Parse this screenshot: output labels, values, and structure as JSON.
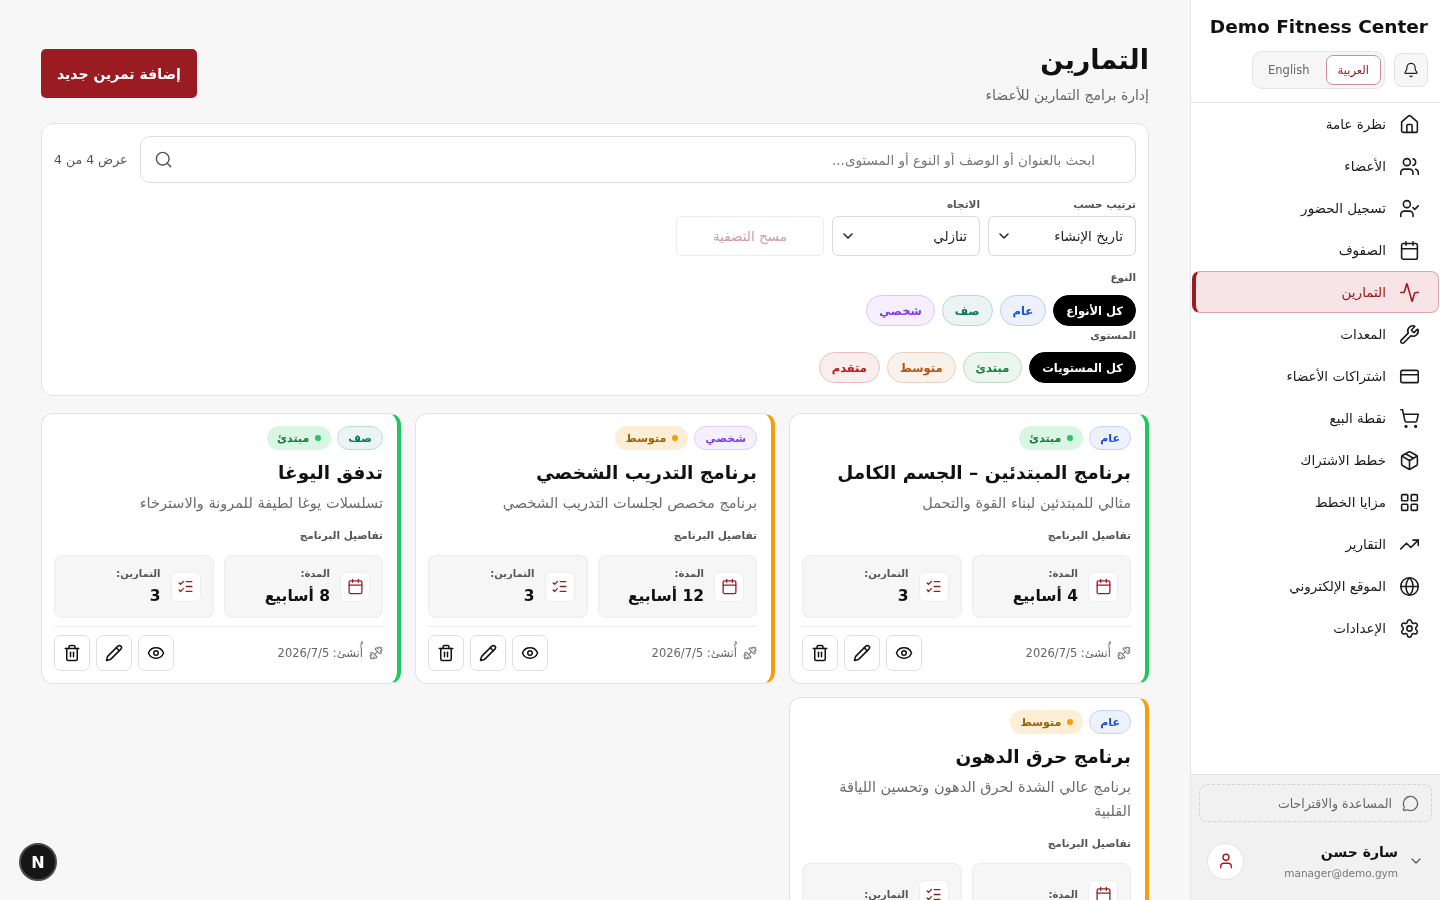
{
  "sidebar": {
    "brand": "Demo Fitness Center",
    "languages": [
      {
        "label": "العربية",
        "selected": true
      },
      {
        "label": "English",
        "selected": false
      }
    ],
    "nav": [
      {
        "label": "نظرة عامة",
        "selected": false
      },
      {
        "label": "الأعضاء",
        "selected": false
      },
      {
        "label": "تسجيل الحضور",
        "selected": false
      },
      {
        "label": "الصفوف",
        "selected": false
      },
      {
        "label": "التمارين",
        "selected": true
      },
      {
        "label": "المعدات",
        "selected": false
      },
      {
        "label": "اشتراكات الأعضاء",
        "selected": false
      },
      {
        "label": "نقطة البيع",
        "selected": false
      },
      {
        "label": "خطط الاشتراك",
        "selected": false
      },
      {
        "label": "مزايا الخطط",
        "selected": false
      },
      {
        "label": "التقارير",
        "selected": false
      },
      {
        "label": "الموقع الإلكتروني",
        "selected": false
      },
      {
        "label": "الإعدادات",
        "selected": false
      }
    ],
    "help_button": "المساعدة والاقتراحات",
    "user": {
      "name": "سارة حسن",
      "email": "manager@demo.gym"
    }
  },
  "header": {
    "title": "التمارين",
    "subtitle": "إدارة برامج التمارين للأعضاء",
    "add_button": "إضافة تمرين جديد"
  },
  "filters": {
    "search": {
      "placeholder": "ابحث بالعنوان أو الوصف أو النوع أو المستوى..."
    },
    "result_count": "عرض 4 من 4",
    "selects": [
      {
        "label": "ترتيب حسب",
        "value": "تاريخ الإنشاء"
      },
      {
        "label": "الاتجاه",
        "value": "تنازلي"
      }
    ],
    "clear_button": {
      "label": "مسح التصفية",
      "disabled": true
    },
    "type_filter": {
      "label": "النوع",
      "chips": [
        {
          "label": "كل الأنواع",
          "selected": true
        },
        {
          "label": "عام",
          "selected": false,
          "color": "#1d4ed8"
        },
        {
          "label": "صف",
          "selected": false,
          "color": "#047857"
        },
        {
          "label": "شخصي",
          "selected": false,
          "color": "#7c3aed"
        }
      ]
    },
    "level_filter": {
      "label": "المستوى",
      "chips": [
        {
          "label": "كل المستويات",
          "selected": true
        },
        {
          "label": "مبتدئ",
          "selected": false,
          "color": "#15803d"
        },
        {
          "label": "متوسط",
          "selected": false,
          "color": "#b45309"
        },
        {
          "label": "متقدم",
          "selected": false,
          "color": "#b91c1c"
        }
      ]
    }
  },
  "programs": [
    {
      "type_tag": {
        "label": "عام",
        "color": "#1d4ed8"
      },
      "level_tag": {
        "label": "مبتدئ",
        "color": "#22c55e"
      },
      "title": "برنامج المبتدئين – الجسم الكامل",
      "description": "مثالي للمبتدئين لبناء القوة والتحمل",
      "details_heading": "تفاصيل البرنامج",
      "stats": [
        {
          "kind": "duration",
          "label": "المدة:",
          "value": "4 أسابيع"
        },
        {
          "kind": "exercises",
          "label": "التمارين:",
          "value": "3"
        }
      ],
      "created": "أُنشئ: 2026/7/5"
    },
    {
      "type_tag": {
        "label": "شخصي",
        "color": "#7c3aed"
      },
      "level_tag": {
        "label": "متوسط",
        "color": "#f59e0b"
      },
      "title": "برنامج التدريب الشخصي",
      "description": "برنامج مخصص لجلسات التدريب الشخصي",
      "details_heading": "تفاصيل البرنامج",
      "stats": [
        {
          "kind": "duration",
          "label": "المدة:",
          "value": "12 أسابيع"
        },
        {
          "kind": "exercises",
          "label": "التمارين:",
          "value": "3"
        }
      ],
      "created": "أُنشئ: 2026/7/5"
    },
    {
      "type_tag": {
        "label": "صف",
        "color": "#047857"
      },
      "level_tag": {
        "label": "مبتدئ",
        "color": "#22c55e"
      },
      "title": "تدفق اليوغا",
      "description": "تسلسلات يوغا لطيفة للمرونة والاسترخاء",
      "details_heading": "تفاصيل البرنامج",
      "stats": [
        {
          "kind": "duration",
          "label": "المدة:",
          "value": "8 أسابيع"
        },
        {
          "kind": "exercises",
          "label": "التمارين:",
          "value": "3"
        }
      ],
      "created": "أُنشئ: 2026/7/5"
    },
    {
      "type_tag": {
        "label": "عام",
        "color": "#1d4ed8"
      },
      "level_tag": {
        "label": "متوسط",
        "color": "#f59e0b"
      },
      "title": "برنامج حرق الدهون",
      "description": "برنامج عالي الشدة لحرق الدهون وتحسين اللياقة القلبية",
      "details_heading": "تفاصيل البرنامج",
      "stats": [
        {
          "kind": "duration",
          "label": "المدة:"
        },
        {
          "kind": "exercises",
          "label": "التمارين:"
        }
      ]
    }
  ],
  "dev_indicator": {
    "label": "N"
  }
}
